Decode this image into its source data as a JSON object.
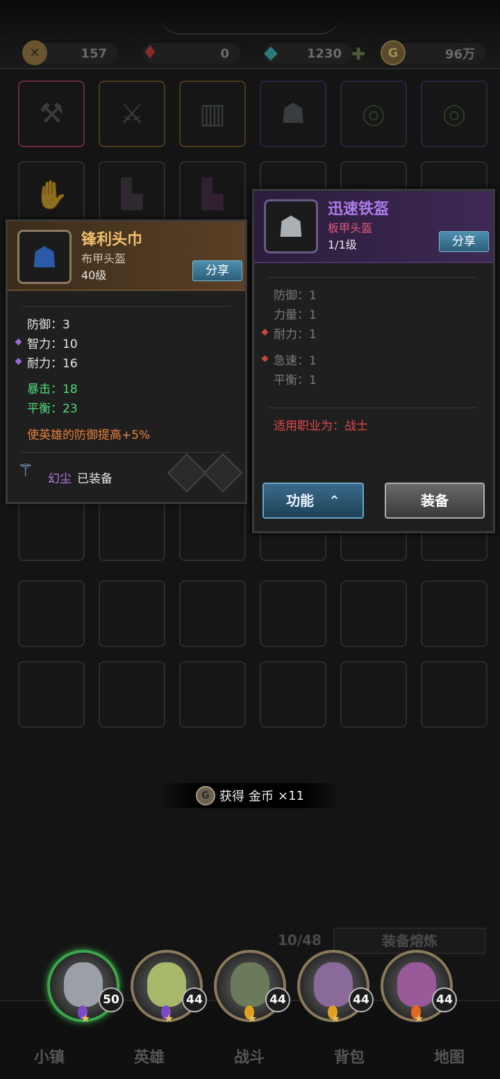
{
  "resources": [
    {
      "icon": "crossed-swords-icon",
      "value": "157"
    },
    {
      "icon": "ruby-icon",
      "value": "0"
    },
    {
      "icon": "diamond-icon",
      "value": "1230"
    },
    {
      "icon": "gold-coin-icon",
      "value": "96万"
    }
  ],
  "left_panel": {
    "name": "锋利头巾",
    "type": "布甲头盔",
    "level": "40级",
    "share": "分享",
    "stats": {
      "def": "防御：3",
      "int": "智力：10",
      "sta": "耐力：16",
      "crit": "暴击：18",
      "bal": "平衡：23"
    },
    "effect": "使英雄的防御提高+5%",
    "equipped_hero": "幻尘",
    "equipped_label": "已装备"
  },
  "right_panel": {
    "name": "迅速铁盔",
    "type": "板甲头盔",
    "level": "1/1级",
    "share": "分享",
    "stats": {
      "def": "防御：1",
      "str": "力量：1",
      "sta": "耐力：1",
      "haste": "急速：1",
      "bal": "平衡：1"
    },
    "class_req": "适用职业为：战士",
    "function_btn": "功能",
    "equip_btn": "装备"
  },
  "toast": {
    "prefix": "获得",
    "item": "金币",
    "count": "×11"
  },
  "inventory": {
    "count": "10/48",
    "smelt": "装备熔炼"
  },
  "heroes": [
    {
      "level": "50"
    },
    {
      "level": "44"
    },
    {
      "level": "44"
    },
    {
      "level": "44"
    },
    {
      "level": "44"
    }
  ],
  "nav": [
    "小镇",
    "英雄",
    "战斗",
    "背包",
    "地图"
  ],
  "colors": {
    "epic_purple": "#b07ce8",
    "rare_orange": "#f0c070",
    "green_stat": "#4fdc7a",
    "effect_orange": "#e8803a",
    "red_req": "#e04848"
  }
}
